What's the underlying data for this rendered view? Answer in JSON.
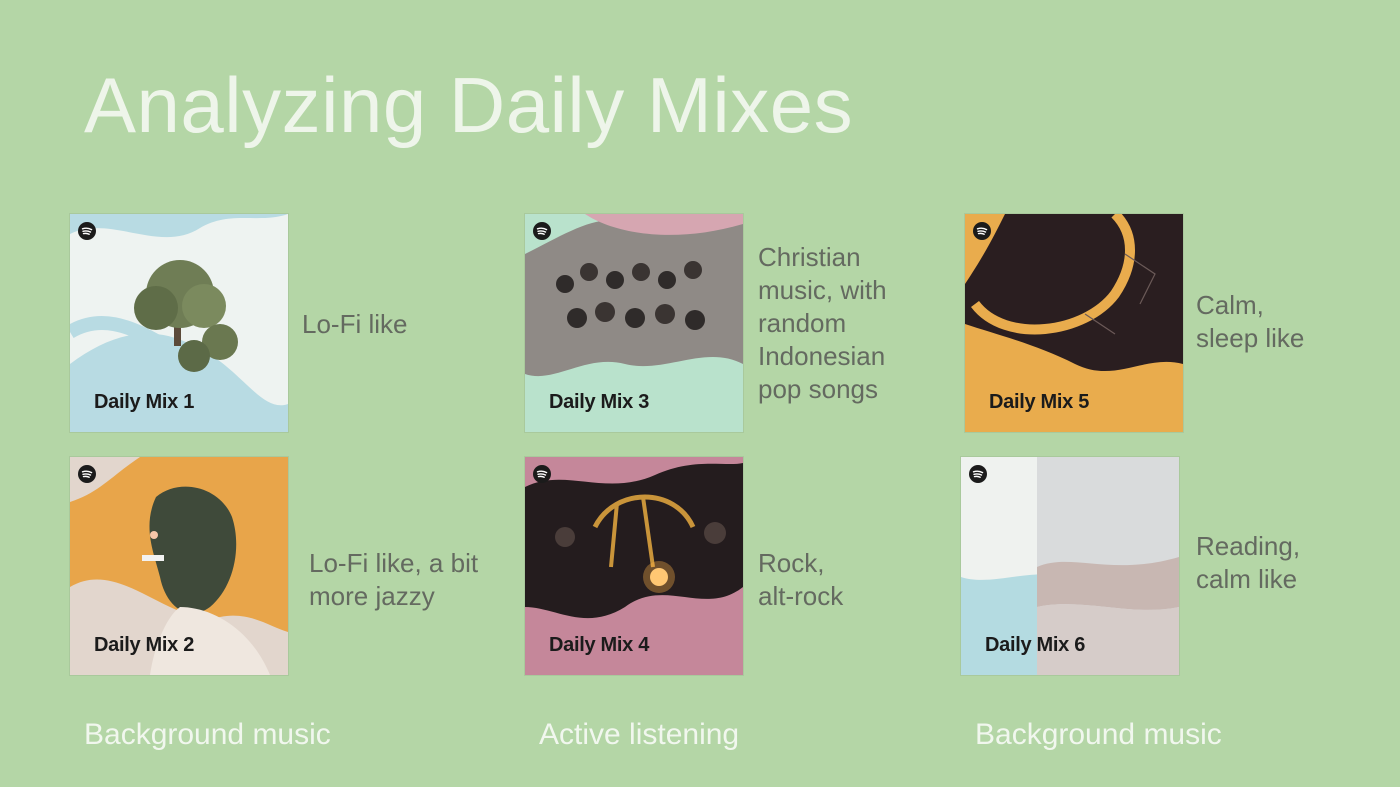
{
  "title": "Analyzing Daily Mixes",
  "mixes": [
    {
      "label": "Daily Mix 1",
      "description": [
        "Lo-Fi like"
      ]
    },
    {
      "label": "Daily Mix 2",
      "description": [
        "Lo-Fi like, a bit",
        "more jazzy"
      ]
    },
    {
      "label": "Daily Mix 3",
      "description": [
        "Christian",
        "music, with",
        "random",
        "Indonesian",
        "pop songs"
      ]
    },
    {
      "label": "Daily Mix 4",
      "description": [
        "Rock,",
        "alt-rock"
      ]
    },
    {
      "label": "Daily Mix 5",
      "description": [
        "Calm,",
        "sleep like"
      ]
    },
    {
      "label": "Daily Mix 6",
      "description": [
        "Reading,",
        "calm like"
      ]
    }
  ],
  "categories": [
    "Background music",
    "Active listening",
    "Background music"
  ],
  "icons": {
    "cover_logo": "spotify-logo-icon"
  },
  "colors": {
    "background": "#b4d6a6",
    "mix1": "#b8dbe3",
    "mix2": "#e8a54a",
    "mix3": "#b9e2cc",
    "mix4": "#c5879a",
    "mix5": "#e9ac4d",
    "mix6": "#b4dbe1"
  }
}
